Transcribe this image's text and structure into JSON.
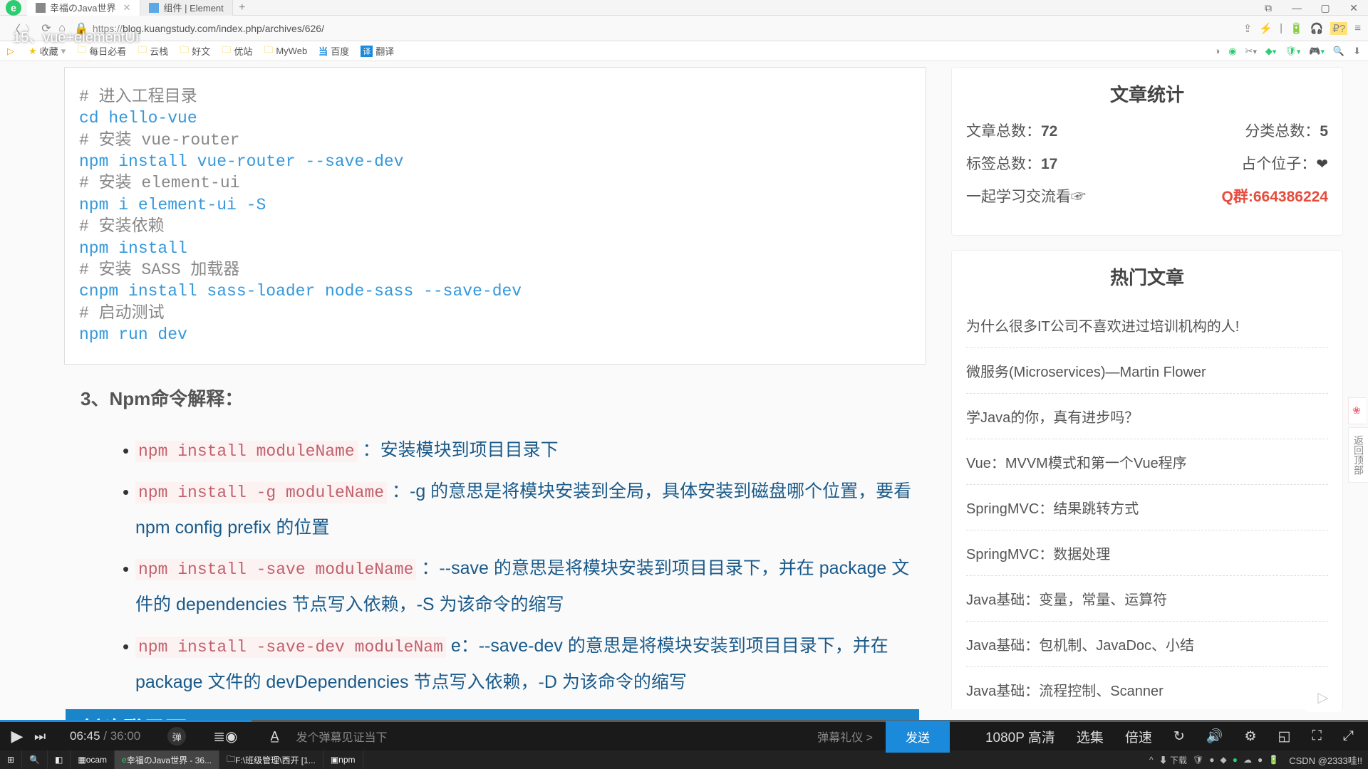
{
  "video_title": "15、vue+elementUI",
  "tabs": [
    {
      "title": "幸福のJava世界",
      "active": true
    },
    {
      "title": "组件 | Element",
      "active": false
    }
  ],
  "url": "https://blog.kuangstudy.com/index.php/archives/626/",
  "url_proto": "https://",
  "url_rest": "blog.kuangstudy.com/index.php/archives/626/",
  "bookmarks": {
    "fav": "收藏",
    "items": [
      "每日必看",
      "云栈",
      "好文",
      "优站",
      "MyWeb",
      "百度",
      "翻译"
    ]
  },
  "code": {
    "c1": "# 进入工程目录",
    "l1": "cd hello-vue",
    "c2": "# 安装 vue-router",
    "l2": "npm install vue-router --save-dev",
    "c3": "# 安装 element-ui",
    "l3": "npm i element-ui -S",
    "c4": "# 安装依赖",
    "l4": "npm install",
    "c5": "# 安装 SASS 加载器",
    "l5": "cnpm install sass-loader node-sass --save-dev",
    "c6": "# 启动测试",
    "l6": "npm run dev"
  },
  "section_title": "3、Npm命令解释：",
  "bullets": [
    {
      "code": "npm install moduleName",
      "text": " ：安装模块到项目目录下"
    },
    {
      "code": "npm install -g moduleName",
      "text": " ：-g 的意思是将模块安装到全局，具体安装到磁盘哪个位置，要看 npm config prefix 的位置"
    },
    {
      "code": "npm install -save moduleName",
      "text": " ：--save 的意思是将模块安装到项目目录下，并在 package 文件的 dependencies 节点写入依赖，-S 为该命令的缩写"
    },
    {
      "code": "npm install -save-dev moduleNam",
      "text": " e：--save-dev 的意思是将模块安装到项目目录下，并在 package 文件的 devDependencies 节点写入依赖，-D 为该命令的缩写"
    }
  ],
  "blue_header": "创建登录页面",
  "sidebar": {
    "stats_title": "文章统计",
    "stats": {
      "l11": "文章总数：",
      "v11": "72",
      "l12": "分类总数：",
      "v12": "5",
      "l21": "标签总数：",
      "v21": "17",
      "l22": "占个位子：",
      "l31": "一起学习交流看☞",
      "v31": "Q群:664386224"
    },
    "hot_title": "热门文章",
    "hot": [
      "为什么很多IT公司不喜欢进过培训机构的人!",
      "微服务(Microservices)—Martin Flower",
      "学Java的你，真有进步吗？",
      "Vue：MVVM模式和第一个Vue程序",
      "SpringMVC：结果跳转方式",
      "SpringMVC：数据处理",
      "Java基础：变量，常量、运算符",
      "Java基础：包机制、JavaDoc、小结",
      "Java基础：流程控制、Scanner"
    ]
  },
  "float_tabs": [
    "返回顶部"
  ],
  "player": {
    "current": "06:45",
    "total": "36:00",
    "time_sep": " / ",
    "danmu_placeholder": "发个弹幕见证当下",
    "gift": "弹幕礼仪 >",
    "send": "发送",
    "quality": "1080P 高清",
    "episodes": "选集",
    "speed": "倍速",
    "danmu_btn": "弹"
  },
  "taskbar": {
    "items": [
      "ocam",
      "幸福のJava世界 - 36...",
      "F:\\班级管理\\西开 [1...",
      "npm"
    ],
    "down": "下载",
    "csdn": "CSDN @2333哇!!"
  }
}
